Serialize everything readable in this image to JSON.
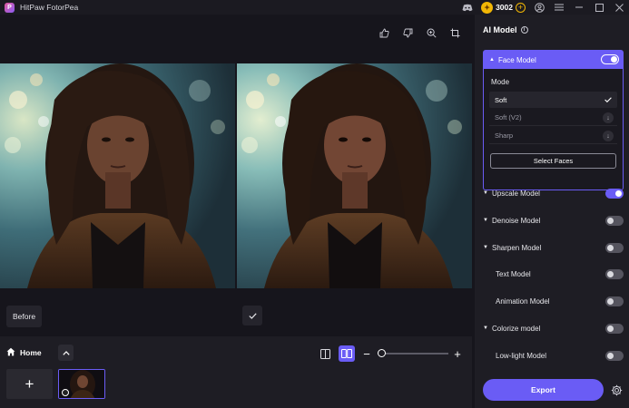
{
  "app": {
    "logo_letter": "P",
    "title": "HitPaw FotorPea"
  },
  "titlebar": {
    "coins": "3002"
  },
  "canvas": {
    "before_label": "Before"
  },
  "bottom": {
    "home_label": "Home"
  },
  "panel": {
    "title": "AI Model",
    "face_model": {
      "label": "Face Model",
      "enabled": true,
      "mode_label": "Mode",
      "modes": [
        {
          "label": "Soft",
          "selected": true
        },
        {
          "label": "Soft (V2)",
          "selected": false
        },
        {
          "label": "Sharp",
          "selected": false
        }
      ],
      "select_faces_label": "Select Faces"
    },
    "models": [
      {
        "label": "Upscale Model",
        "enabled": true,
        "expandable": true
      },
      {
        "label": "Denoise Model",
        "enabled": false,
        "expandable": true
      },
      {
        "label": "Sharpen Model",
        "enabled": false,
        "expandable": true
      },
      {
        "label": "Text Model",
        "enabled": false,
        "expandable": false
      },
      {
        "label": "Animation Model",
        "enabled": false,
        "expandable": false
      },
      {
        "label": "Colorize model",
        "enabled": false,
        "expandable": true
      },
      {
        "label": "Low-light Model",
        "enabled": false,
        "expandable": false
      }
    ],
    "export_label": "Export"
  },
  "colors": {
    "accent": "#6a5cf5",
    "coin": "#f2b705",
    "panel_bg": "#1e1d24"
  }
}
